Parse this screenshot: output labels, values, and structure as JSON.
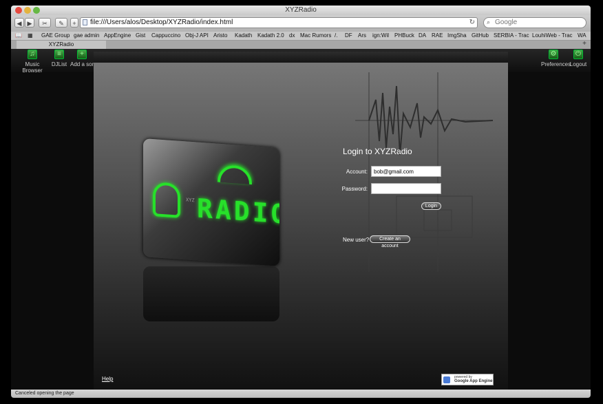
{
  "window": {
    "title": "XYZRadio"
  },
  "toolbar": {
    "url": "file:///Users/alos/Desktop/XYZRadio/index.html",
    "search_placeholder": "Google"
  },
  "bookmarks": [
    "GAE Group",
    "gae admin",
    "AppEngine",
    "Gist",
    "Cappuccino",
    "Obj-J API",
    "Aristo",
    "Kadath",
    "Kadath 2.0",
    "dx",
    "Mac Rumors",
    "/.",
    "DF",
    "Ars",
    "ign:Wil",
    "PHBuck",
    "DA",
    "RAE",
    "ImgSha",
    "GitHub",
    "SERBIA - Trac",
    "LouhiWeb - Trac",
    "WA"
  ],
  "tab": {
    "label": "XYZRadio"
  },
  "app_toolbar": {
    "left": [
      {
        "label": "Music Browser",
        "icon": "music-icon"
      },
      {
        "label": "DJList",
        "icon": "playlist-icon"
      },
      {
        "label": "Add a song",
        "icon": "add-song-icon"
      }
    ],
    "right": [
      {
        "label": "Preferences",
        "icon": "preferences-icon"
      },
      {
        "label": "Logout",
        "icon": "logout-icon"
      }
    ]
  },
  "login": {
    "title": "Login to XYZRadio",
    "account_label": "Account:",
    "account_value": "bob@gmail.com",
    "password_label": "Password:",
    "login_button": "Login",
    "new_user_label": "New user?",
    "create_account_button": "Create an account"
  },
  "logo": {
    "text": "RADIO",
    "small_text": "XYZ"
  },
  "footer": {
    "help_link": "Help",
    "badge_line1": "powered by",
    "badge_line2": "Google App Engine"
  },
  "statusbar": {
    "text": "Canceled opening the page"
  },
  "colors": {
    "accent_green": "#27e02a",
    "panel_dark": "#1a1a1a"
  }
}
